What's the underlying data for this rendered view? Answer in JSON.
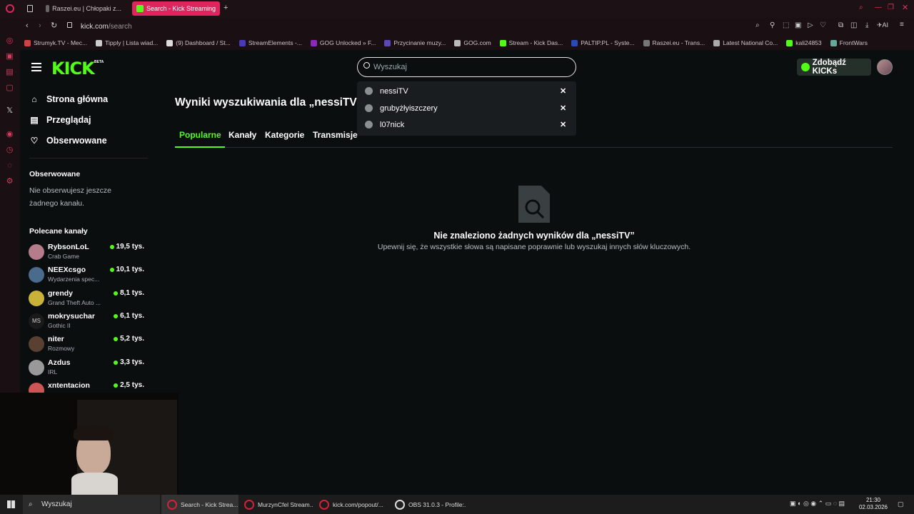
{
  "tabs": [
    {
      "label": "Raszei.eu | Chłopaki z..."
    },
    {
      "label": "Search - Kick Streaming"
    }
  ],
  "address": {
    "url": "kick.com",
    "path": "/search"
  },
  "bookmarks": [
    "Strumyk.TV - Mec...",
    "Tipply | Lista wiad...",
    "(9) Dashboard / St...",
    "StreamElements -...",
    "GOG Unlocked » F...",
    "Przycinanie muzy...",
    "GOG.com",
    "Stream - Kick Das...",
    "PALTIP.PL - Syste...",
    "Raszei.eu - Trans...",
    "Latest National Co...",
    "kali24853",
    "FrontWars"
  ],
  "header": {
    "logo": "KICK",
    "beta": "BETA",
    "search_placeholder": "Wyszukaj",
    "kicks_button": "Zdobądź KICKs"
  },
  "nav": [
    {
      "label": "Strona główna"
    },
    {
      "label": "Przeglądaj"
    },
    {
      "label": "Obserwowane"
    }
  ],
  "followed": {
    "title": "Obserwowane",
    "empty_text": "Nie obserwujesz jeszcze żadnego kanału."
  },
  "recommended": {
    "title": "Polecane kanały",
    "channels": [
      {
        "name": "RybsonLoL",
        "game": "Crab Game",
        "viewers": "19,5 tys."
      },
      {
        "name": "NEEXcsgo",
        "game": "Wydarzenia spec...",
        "viewers": "10,1 tys."
      },
      {
        "name": "grendy",
        "game": "Grand Theft Auto ...",
        "viewers": "8,1 tys."
      },
      {
        "name": "mokrysuchar",
        "game": "Gothic II",
        "viewers": "6,1 tys."
      },
      {
        "name": "niter",
        "game": "Rozmowy",
        "viewers": "5,2 tys."
      },
      {
        "name": "Azdus",
        "game": "IRL",
        "viewers": "3,3 tys."
      },
      {
        "name": "xntentacion",
        "game": "",
        "viewers": "2,5 tys."
      }
    ]
  },
  "results": {
    "title": "Wyniki wyszukiwania dla „nessiTV”",
    "tabs": [
      "Popularne",
      "Kanały",
      "Kategorie",
      "Transmisje"
    ],
    "empty_title": "Nie znaleziono żadnych wyników dla „nessiTV”",
    "empty_sub": "Upewnij się, że wszystkie słowa są napisane poprawnie lub wyszukaj innych słów kluczowych."
  },
  "history": [
    "nessiTV",
    "grubyżłyiszczery",
    "l07nick"
  ],
  "taskbar": {
    "search": "Wyszukaj",
    "apps": [
      "Search - Kick Strea...",
      "MurzynCfel Stream...",
      "kick.com/popout/...",
      "OBS 31.0.3 - Profile:..."
    ],
    "time": "21:30",
    "date": "02.03.2026"
  },
  "colors": {
    "accent": "#53fc18",
    "browser_tab": "#e0245e"
  }
}
